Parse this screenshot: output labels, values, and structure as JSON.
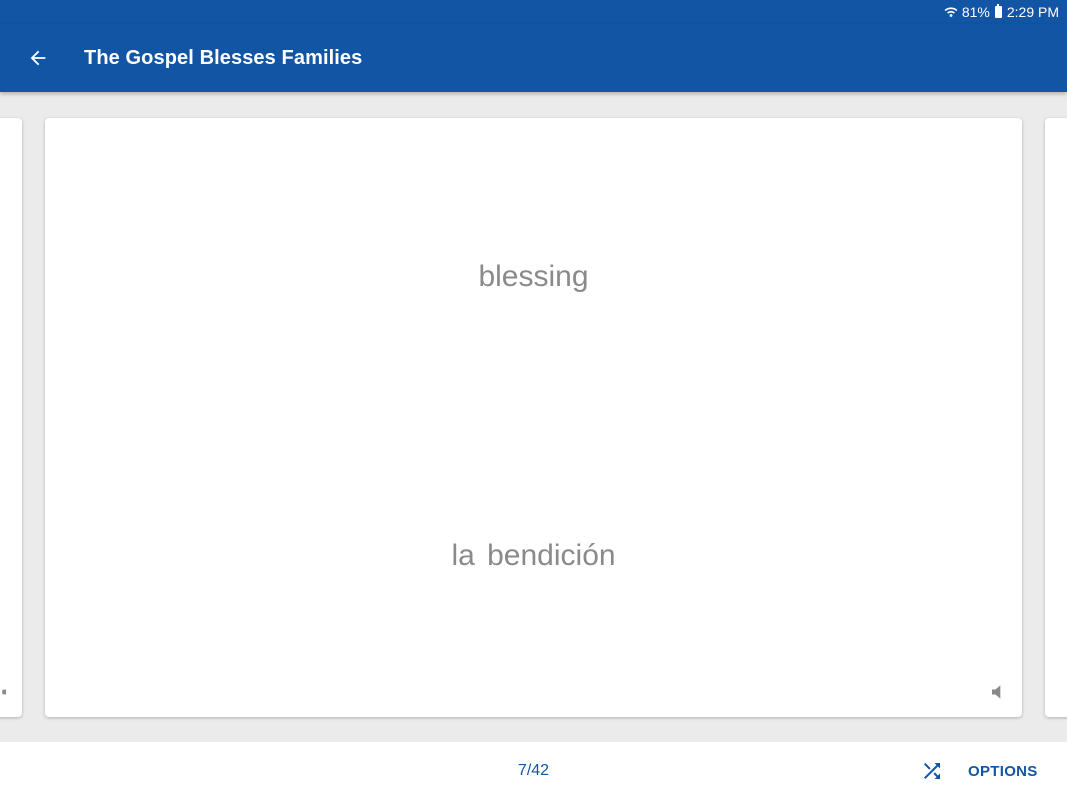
{
  "status_bar": {
    "battery": "81%",
    "time": "2:29 PM"
  },
  "app_bar": {
    "title": "The Gospel Blesses Families"
  },
  "card": {
    "term": "blessing",
    "definition": "la  bendición"
  },
  "bottom_bar": {
    "counter": "7/42",
    "options_label": "OPTIONS"
  },
  "icons": {
    "back": "arrow-left-icon",
    "shuffle": "shuffle-icon",
    "audio": "speaker-icon",
    "wifi": "wifi-icon",
    "battery": "battery-icon"
  },
  "colors": {
    "primary": "#1255a5",
    "card_text": "#8a8a8a",
    "background": "#ebebeb"
  }
}
